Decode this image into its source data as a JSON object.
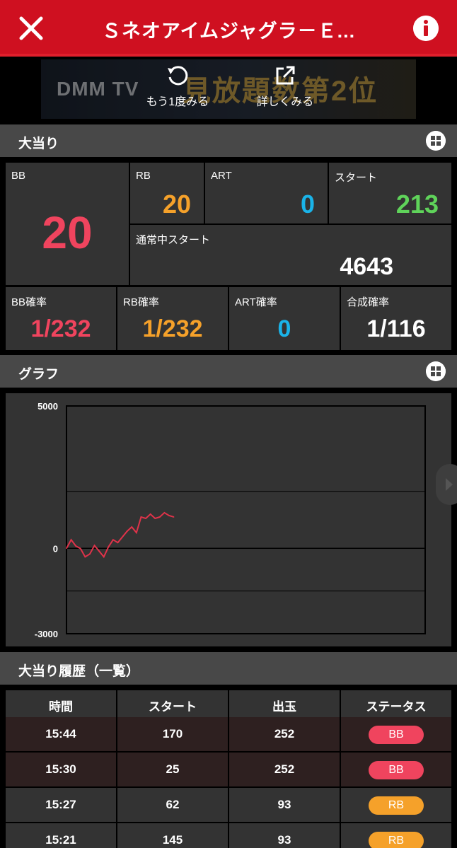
{
  "header": {
    "title": "Ｓネオアイムジャグラ－Ｅ...",
    "close_icon": "close-icon",
    "info_icon": "info-icon"
  },
  "ad": {
    "brand": "DMM TV",
    "promo": "見放題数第2位",
    "replay_label": "もう1度みる",
    "detail_label": "詳しくみる"
  },
  "sections": {
    "hits": "大当り",
    "graph": "グラフ",
    "history": "大当り履歴（一覧）"
  },
  "stats": {
    "bb": {
      "label": "BB",
      "value": "20"
    },
    "rb": {
      "label": "RB",
      "value": "20"
    },
    "art": {
      "label": "ART",
      "value": "0"
    },
    "start": {
      "label": "スタート",
      "value": "213"
    },
    "normal_start": {
      "label": "通常中スタート",
      "value": "4643"
    },
    "bb_rate": {
      "label": "BB確率",
      "value": "1/232"
    },
    "rb_rate": {
      "label": "RB確率",
      "value": "1/232"
    },
    "art_rate": {
      "label": "ART確率",
      "value": "0"
    },
    "total_rate": {
      "label": "合成確率",
      "value": "1/116"
    }
  },
  "colors": {
    "bb": "#f0445e",
    "rb": "#f5a12a",
    "art": "#1ab3e8",
    "start": "#5fd35a",
    "accent": "#cf1020"
  },
  "chart_data": {
    "type": "line",
    "yticks": [
      "5000",
      "0",
      "-3000"
    ],
    "ylim": [
      -3000,
      5000
    ],
    "x": [
      0,
      1,
      2,
      3,
      4,
      5,
      6,
      7,
      8,
      9,
      10,
      11,
      12,
      13,
      14,
      15,
      16,
      17,
      18,
      19,
      20,
      21,
      22,
      23
    ],
    "values": [
      0,
      300,
      80,
      -10,
      -300,
      -200,
      100,
      -100,
      -300,
      50,
      300,
      200,
      400,
      600,
      750,
      550,
      1100,
      1050,
      1200,
      1050,
      1100,
      1250,
      1150,
      1100
    ],
    "line_color": "#e0334a",
    "grid": true
  },
  "history": {
    "headers": [
      "時間",
      "スタート",
      "出玉",
      "ステータス"
    ],
    "rows": [
      {
        "time": "15:44",
        "start": "170",
        "payout": "252",
        "status": "BB"
      },
      {
        "time": "15:30",
        "start": "25",
        "payout": "252",
        "status": "BB"
      },
      {
        "time": "15:27",
        "start": "62",
        "payout": "93",
        "status": "RB"
      },
      {
        "time": "15:21",
        "start": "145",
        "payout": "93",
        "status": "RB"
      }
    ]
  }
}
